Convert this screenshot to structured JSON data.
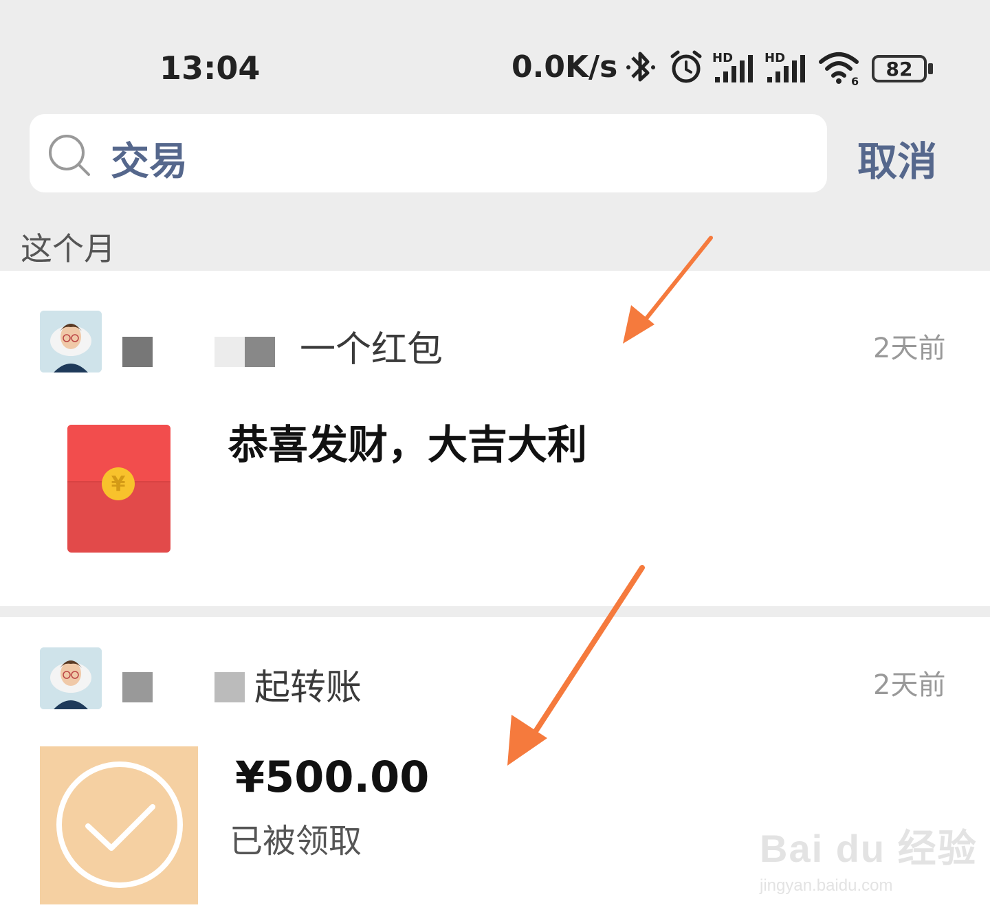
{
  "status_bar": {
    "time": "13:04",
    "net_speed": "0.0K/s",
    "battery": "82",
    "icons": [
      "bluetooth-icon",
      "alarm-icon",
      "hd-signal-icon",
      "hd-signal-icon",
      "wifi-icon",
      "battery-icon"
    ],
    "hd_label": "HD",
    "wifi_label": "6"
  },
  "search": {
    "value": "交易",
    "icon": "search-icon",
    "cancel_label": "取消"
  },
  "section": {
    "label": "这个月"
  },
  "records": [
    {
      "title": "一个红包",
      "time": "2天前",
      "message": "恭喜发财，大吉大利",
      "thumbnail": "red-packet-icon",
      "coin_symbol": "¥"
    },
    {
      "title": "起转账",
      "time": "2天前",
      "amount": "¥500.00",
      "status": "已被领取",
      "thumbnail": "transfer-received-icon"
    }
  ],
  "colors": {
    "background": "#ededed",
    "accent": "#55678c",
    "arrow": "#f57a3d",
    "red_packet": "#e24a4a",
    "transfer": "#f5d0a2"
  },
  "watermark": {
    "brand": "Bai du 经验",
    "url": "jingyan.baidu.com"
  }
}
